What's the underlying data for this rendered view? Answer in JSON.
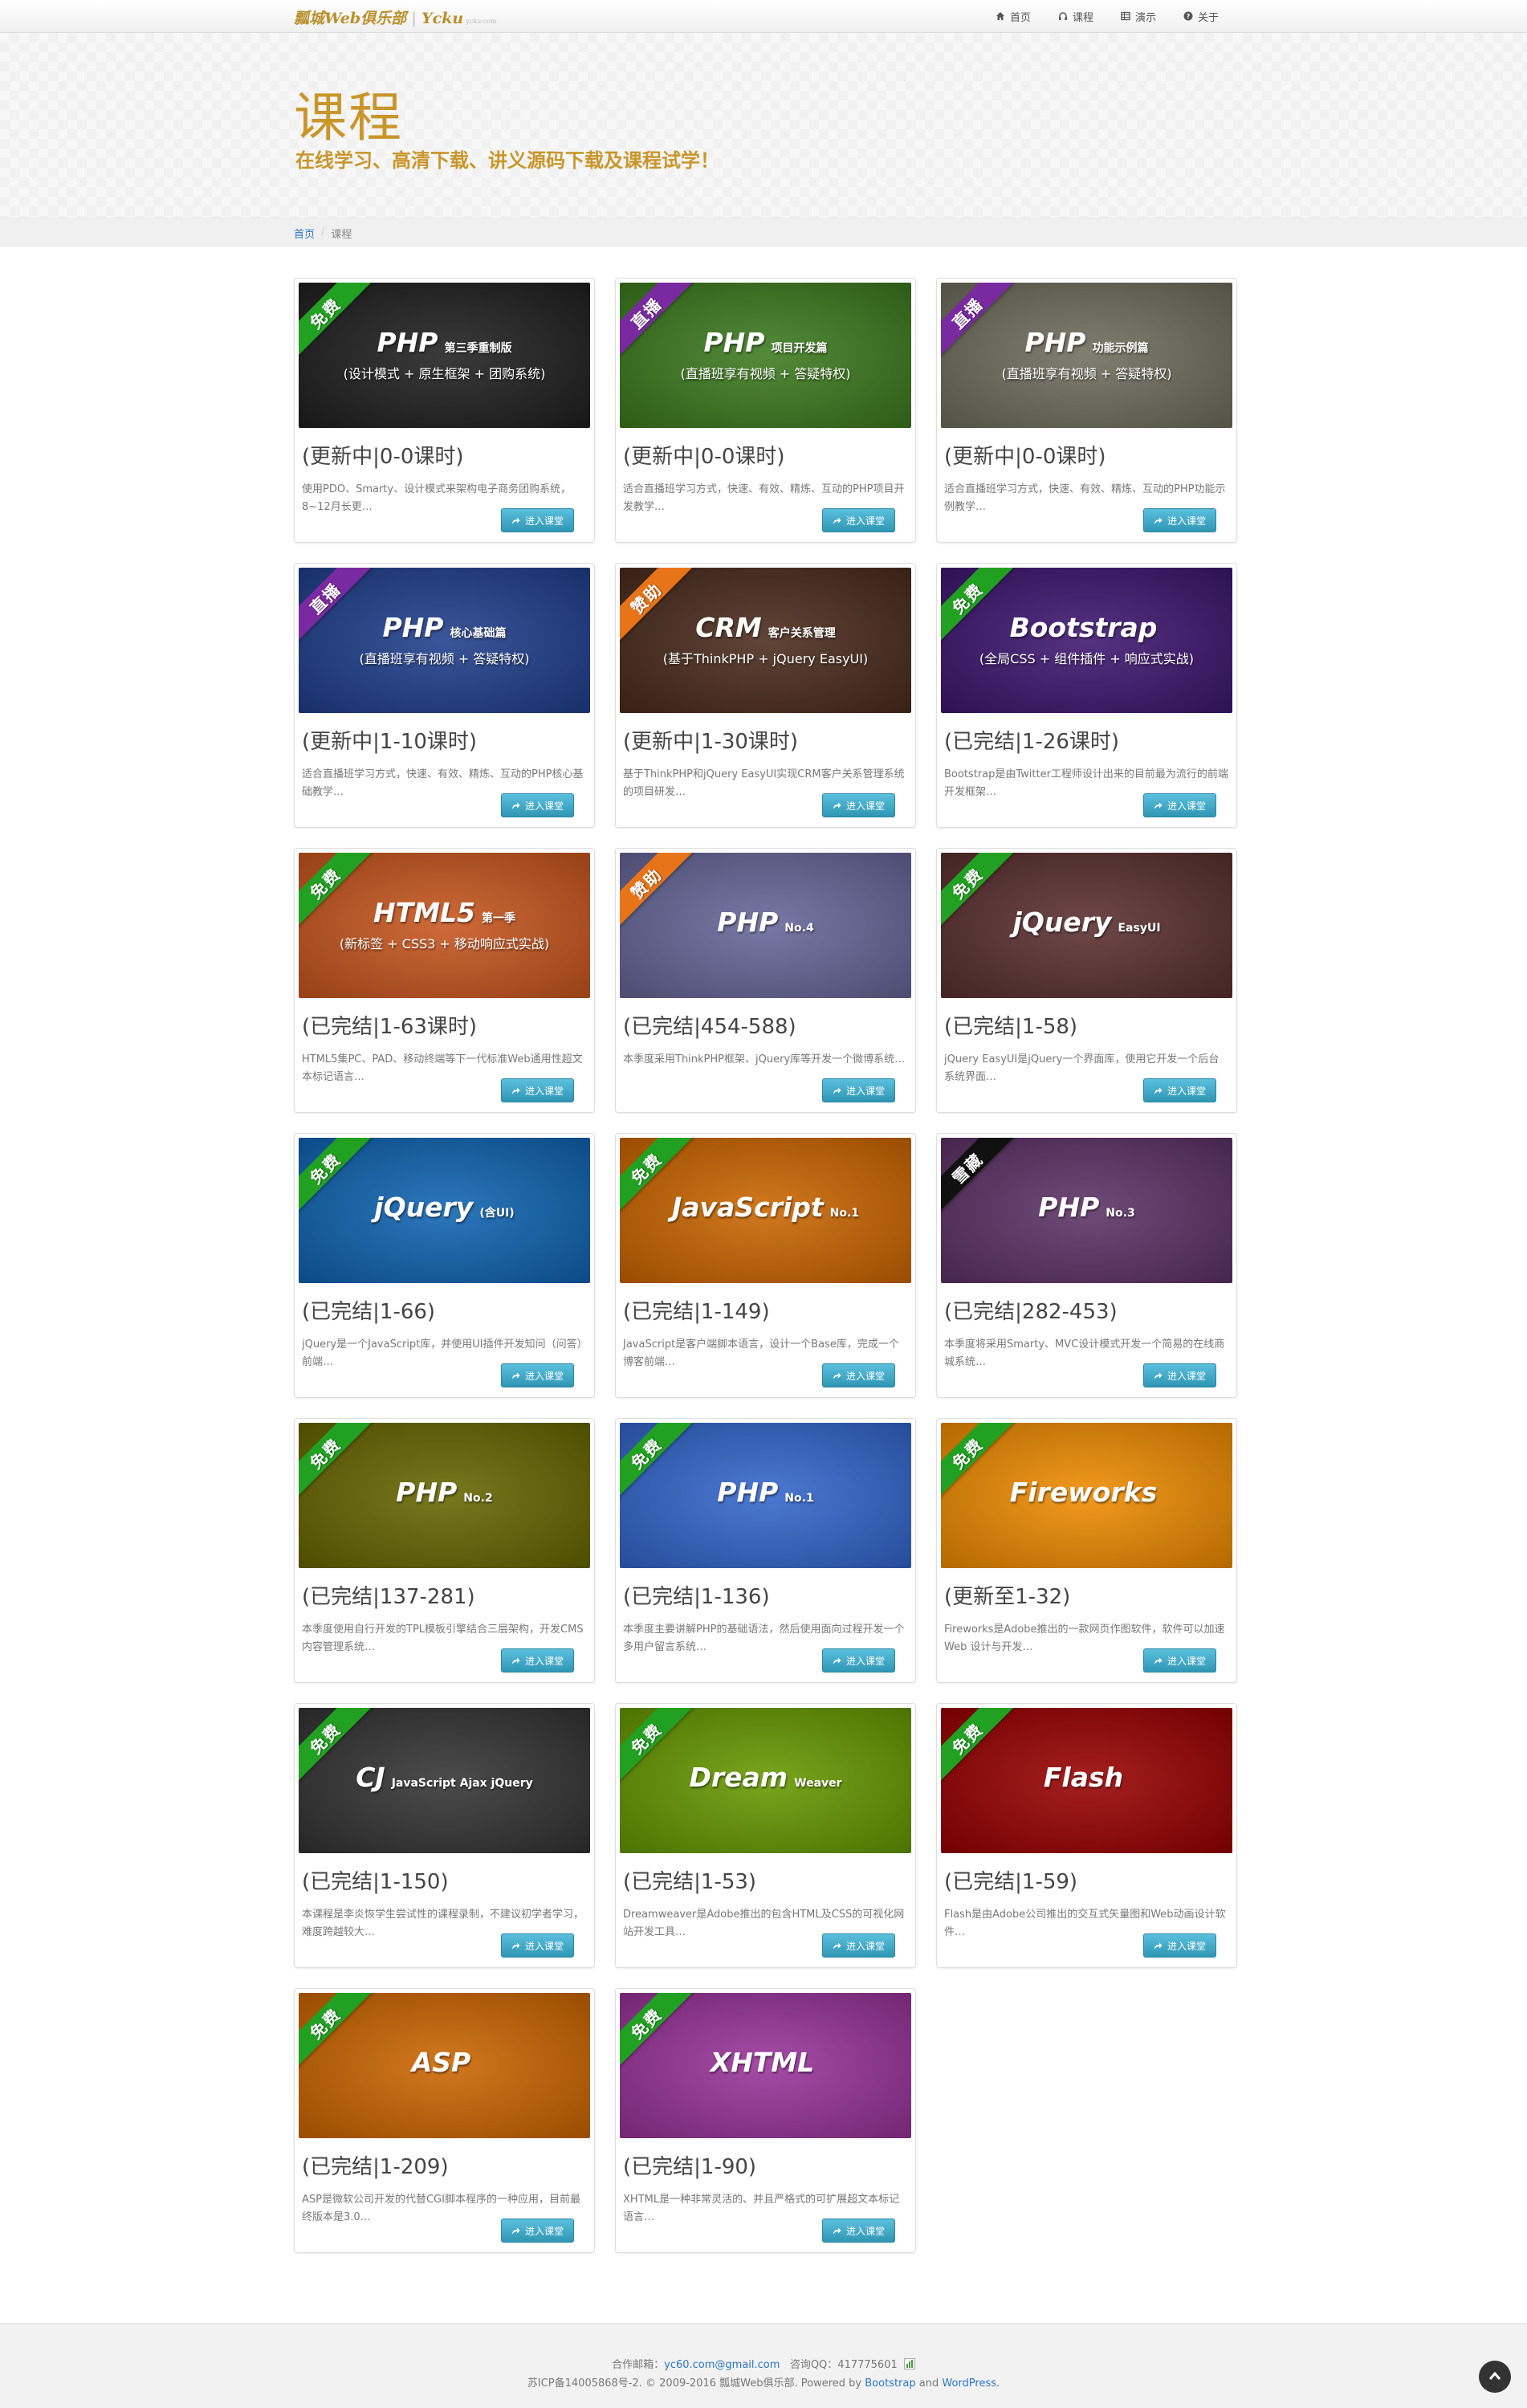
{
  "brand": {
    "name": "瓢城Web俱乐部",
    "partner": "Ycku",
    "partner_sub": "ycku.com"
  },
  "nav": [
    {
      "label": "首页",
      "icon": "home-icon"
    },
    {
      "label": "课程",
      "icon": "headphones-icon"
    },
    {
      "label": "演示",
      "icon": "table-icon"
    },
    {
      "label": "关于",
      "icon": "question-circle-icon"
    }
  ],
  "hero": {
    "title": "课程",
    "subtitle": "在线学习、高清下载、讲义源码下载及课程试学！"
  },
  "breadcrumb": {
    "home": "首页",
    "separator": "/",
    "current": "课程"
  },
  "enter_label": "进入课堂",
  "courses": [
    {
      "tag": "免费",
      "tag_color": "#22a022",
      "bg": "#1f1f1f",
      "main": "PHP",
      "side": "第三季重制版",
      "sub": "(设计模式 + 原生框架 + 团购系统)",
      "status": "(更新中|0-0课时)",
      "desc": "使用PDO、Smarty、设计模式来架构电子商务团购系统，8~12月长更…"
    },
    {
      "tag": "直播",
      "tag_color": "#7a2aa0",
      "bg": "#3c7a1e",
      "main": "PHP",
      "side": "项目开发篇",
      "sub": "(直播班享有视频 + 答疑特权)",
      "status": "(更新中|0-0课时)",
      "desc": "适合直播班学习方式，快速、有效、精炼、互动的PHP项目开发教学…"
    },
    {
      "tag": "直播",
      "tag_color": "#7a2aa0",
      "bg": "#6f6d5d",
      "main": "PHP",
      "side": "功能示例篇",
      "sub": "(直播班享有视频 + 答疑特权)",
      "status": "(更新中|0-0课时)",
      "desc": "适合直播班学习方式，快速、有效、精炼、互动的PHP功能示例教学…"
    },
    {
      "tag": "直播",
      "tag_color": "#7a2aa0",
      "bg": "#1f3e8c",
      "main": "PHP",
      "side": "核心基础篇",
      "sub": "(直播班享有视频 + 答疑特权)",
      "status": "(更新中|1-10课时)",
      "desc": "适合直播班学习方式，快速、有效、精炼、互动的PHP核心基础教学…"
    },
    {
      "tag": "赞助",
      "tag_color": "#e8741a",
      "bg": "#4a2b1c",
      "main": "CRM",
      "side": "客户关系管理",
      "sub": "(基于ThinkPHP + jQuery EasyUI)",
      "status": "(更新中|1-30课时)",
      "desc": "基于ThinkPHP和jQuery EasyUI实现CRM客户关系管理系统的项目研发…"
    },
    {
      "tag": "免费",
      "tag_color": "#22a022",
      "bg": "#3d1670",
      "main": "Bootstrap",
      "side": "",
      "sub": "(全局CSS + 组件插件 + 响应式实战)",
      "status": "(已完结|1-26课时)",
      "desc": "Bootstrap是由Twitter工程师设计出来的目前最为流行的前端开发框架…"
    },
    {
      "tag": "免费",
      "tag_color": "#22a022",
      "bg": "#c8561e",
      "main": "HTML5",
      "side": "第一季",
      "sub": "(新标签 + CSS3 + 移动响应式实战)",
      "status": "(已完结|1-63课时)",
      "desc": "HTML5集PC、PAD、移动终端等下一代标准Web通用性超文本标记语言…"
    },
    {
      "tag": "赞助",
      "tag_color": "#e8741a",
      "bg": "#666699",
      "main": "PHP",
      "side": "No.4",
      "sub": "",
      "status": "(已完结|454-588)",
      "desc": "本季度采用ThinkPHP框架、jQuery库等开发一个微博系统…"
    },
    {
      "tag": "免费",
      "tag_color": "#22a022",
      "bg": "#5b2f2f",
      "main": "jQuery",
      "side": "EasyUI",
      "sub": "",
      "status": "(已完结|1-58)",
      "desc": "jQuery EasyUI是jQuery一个界面库，使用它开发一个后台系统界面…"
    },
    {
      "tag": "免费",
      "tag_color": "#22a022",
      "bg": "#0f64b2",
      "main": "jQuery",
      "side": "(含UI)",
      "sub": "",
      "status": "(已完结|1-66)",
      "desc": "jQuery是一个JavaScript库，并使用UI插件开发知问（问答）前端…"
    },
    {
      "tag": "免费",
      "tag_color": "#22a022",
      "bg": "#cc6600",
      "main": "JavaScript",
      "side": "No.1",
      "sub": "",
      "status": "(已完结|1-149)",
      "desc": "JavaScript是客户端脚本语言，设计一个Base库，完成一个博客前端…"
    },
    {
      "tag": "雪藏",
      "tag_color": "#111111",
      "bg": "#5c3266",
      "main": "PHP",
      "side": "No.3",
      "sub": "",
      "status": "(已完结|282-453)",
      "desc": "本季度将采用Smarty、MVC设计模式开发一个简易的在线商城系统…"
    },
    {
      "tag": "免费",
      "tag_color": "#22a022",
      "bg": "#666600",
      "main": "PHP",
      "side": "No.2",
      "sub": "",
      "status": "(已完结|137-281)",
      "desc": "本季度使用自行开发的TPL模板引擎结合三层架构，开发CMS内容管理系统…"
    },
    {
      "tag": "免费",
      "tag_color": "#22a022",
      "bg": "#3366cc",
      "main": "PHP",
      "side": "No.1",
      "sub": "",
      "status": "(已完结|1-136)",
      "desc": "本季度主要讲解PHP的基础语法，然后使用面向过程开发一个多用户留言系统…"
    },
    {
      "tag": "免费",
      "tag_color": "#22a022",
      "bg": "#f08c00",
      "main": "Fireworks",
      "side": "",
      "sub": "",
      "status": "(更新至1-32)",
      "desc": "Fireworks是Adobe推出的一款网页作图软件，软件可以加速 Web 设计与开发…"
    },
    {
      "tag": "免费",
      "tag_color": "#22a022",
      "bg": "#333333",
      "main": "CJ",
      "side": "JavaScript Ajax jQuery",
      "sub": "",
      "status": "(已完结|1-150)",
      "desc": "本课程是李炎恢学生尝试性的课程录制，不建议初学者学习，难度跨越较大…"
    },
    {
      "tag": "免费",
      "tag_color": "#22a022",
      "bg": "#669900",
      "main": "Dream",
      "side": "Weaver",
      "sub": "",
      "status": "(已完结|1-53)",
      "desc": "Dreamweaver是Adobe推出的包含HTML及CSS的可视化网站开发工具…"
    },
    {
      "tag": "免费",
      "tag_color": "#22a022",
      "bg": "#990000",
      "main": "Flash",
      "side": "",
      "sub": "",
      "status": "(已完结|1-59)",
      "desc": "Flash是由Adobe公司推出的交互式矢量图和Web动画设计软件…"
    },
    {
      "tag": "免费",
      "tag_color": "#22a022",
      "bg": "#cc6600",
      "main": "ASP",
      "side": "",
      "sub": "",
      "status": "(已完结|1-209)",
      "desc": "ASP是微软公司开发的代替CGI脚本程序的一种应用，目前最终版本是3.0…"
    },
    {
      "tag": "免费",
      "tag_color": "#22a022",
      "bg": "#993399",
      "main": "XHTML",
      "side": "",
      "sub": "",
      "status": "(已完结|1-90)",
      "desc": "XHTML是一种非常灵活的、并且严格式的可扩展超文本标记语言…"
    }
  ],
  "footer": {
    "mail_label": "合作邮箱：",
    "mail": "yc60.com@gmail.com",
    "qq": "咨询QQ：417775601",
    "icp": "苏ICP备14005868号-2. © 2009-2016 瓢城Web俱乐部. Powered by",
    "bootstrap": "Bootstrap",
    "and": "and",
    "wordpress": "WordPress."
  }
}
